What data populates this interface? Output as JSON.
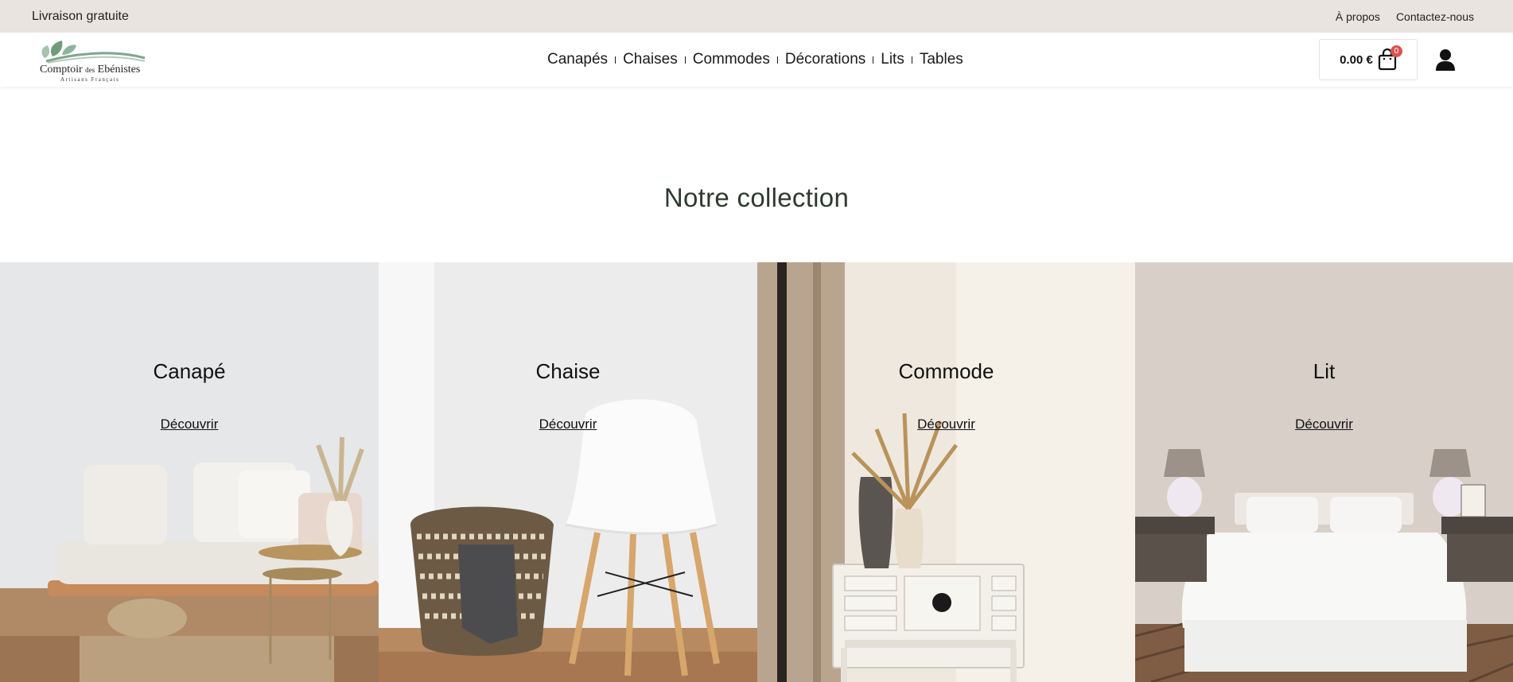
{
  "topbar": {
    "promo": "Livraison gratuite",
    "links": [
      "À propos",
      "Contactez-nous"
    ]
  },
  "header": {
    "logo": {
      "name_main": "Comptoir",
      "name_small": "des",
      "name_end": "Ebénistes",
      "tagline": "Artisans Français"
    },
    "nav": [
      "Canapés",
      "Chaises",
      "Commodes",
      "Décorations",
      "Lits",
      "Tables"
    ],
    "cart": {
      "total": "0.00 €",
      "count": "0",
      "icon": "shopping-bag-icon"
    },
    "account_icon": "user-icon"
  },
  "main": {
    "heading": "Notre collection",
    "categories": [
      {
        "title": "Canapé",
        "link": "Découvrir"
      },
      {
        "title": "Chaise",
        "link": "Découvrir"
      },
      {
        "title": "Commode",
        "link": "Découvrir"
      },
      {
        "title": "Lit",
        "link": "Découvrir"
      }
    ]
  },
  "colors": {
    "topbar_bg": "#e9e4df",
    "heading_green": "#2c3a2f",
    "badge_red": "#d9534f"
  }
}
